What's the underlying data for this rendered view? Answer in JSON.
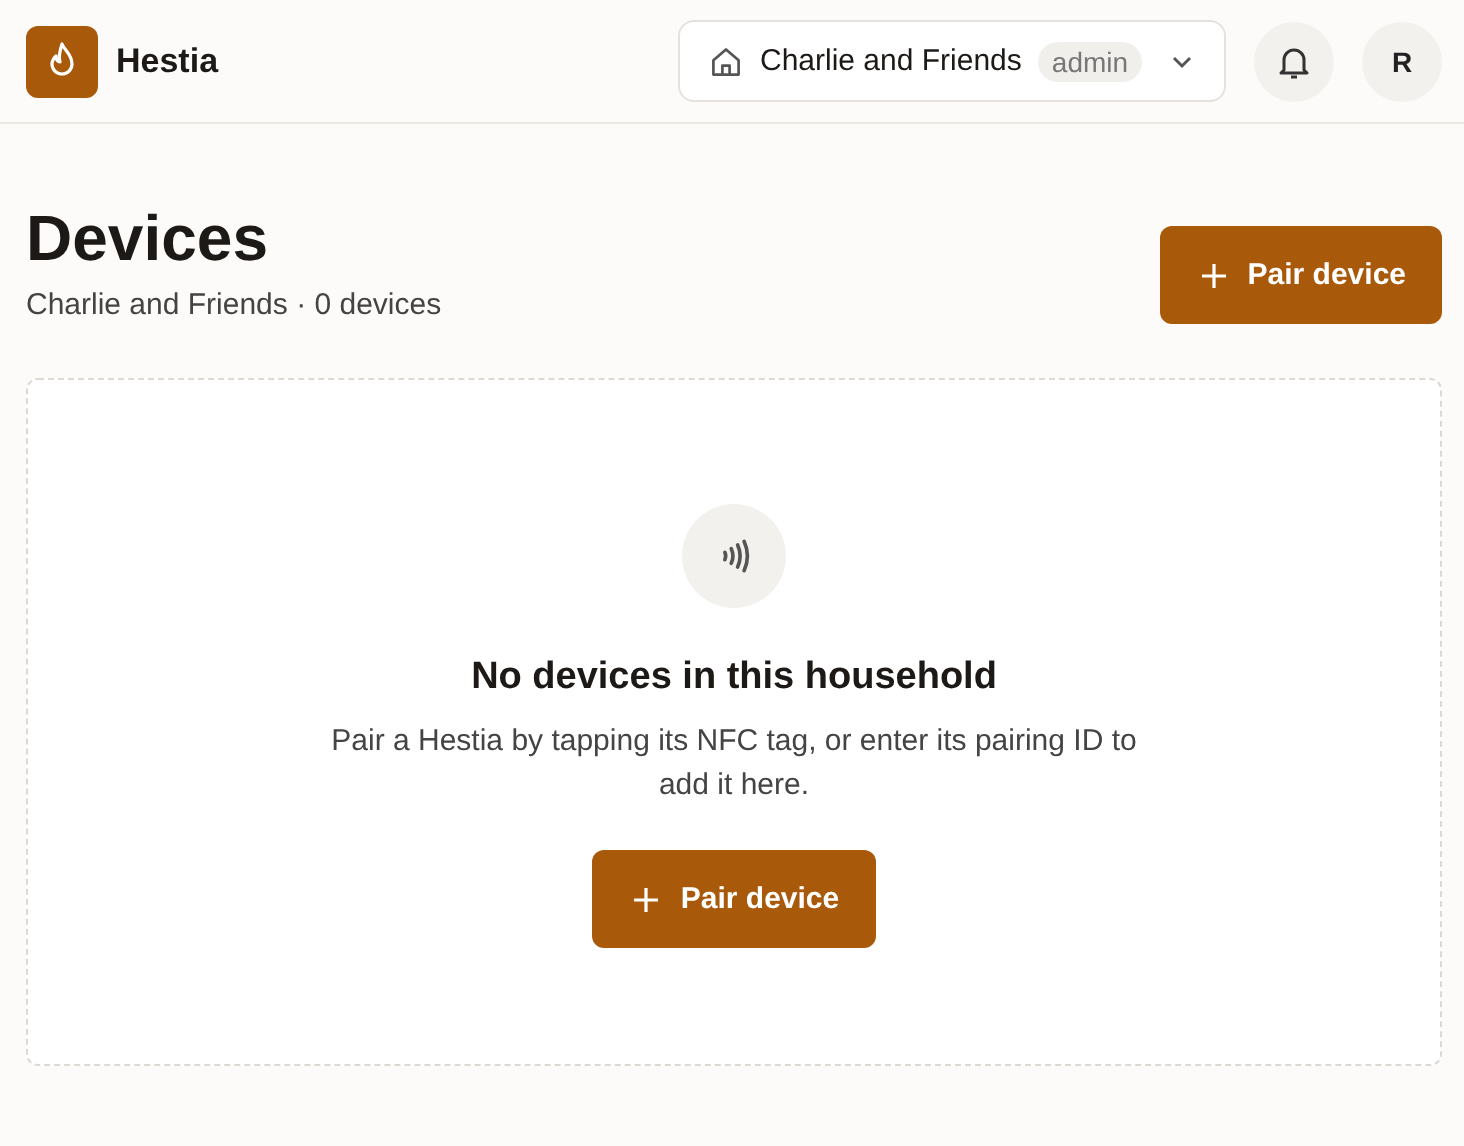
{
  "header": {
    "app_name": "Hestia",
    "household": {
      "name": "Charlie and Friends",
      "role": "admin"
    },
    "avatar_initial": "R"
  },
  "page": {
    "title": "Devices",
    "subtitle": "Charlie and Friends · 0 devices",
    "action": "Pair device"
  },
  "empty_state": {
    "title": "No devices in this household",
    "text": "Pair a Hestia by tapping its NFC tag, or enter its pairing ID to add it here.",
    "action": "Pair device"
  }
}
